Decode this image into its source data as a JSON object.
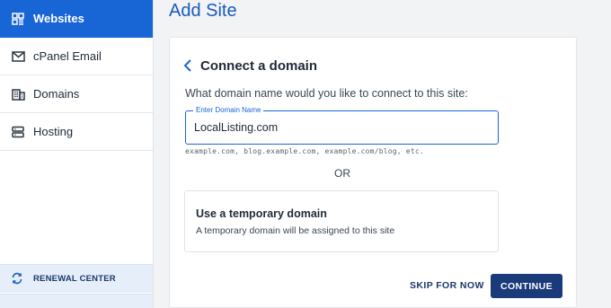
{
  "sidebar": {
    "items": [
      {
        "label": "Websites",
        "icon": "websites-grid-icon",
        "active": true
      },
      {
        "label": "cPanel Email",
        "icon": "envelope-icon",
        "active": false
      },
      {
        "label": "Domains",
        "icon": "building-icon",
        "active": false
      },
      {
        "label": "Hosting",
        "icon": "server-icon",
        "active": false
      }
    ],
    "renewal": {
      "label": "RENEWAL CENTER",
      "icon": "refresh-icon"
    }
  },
  "main": {
    "page_title": "Add Site",
    "card": {
      "heading": "Connect a domain",
      "back_icon": "chevron-left-icon",
      "question": "What domain name would you like to connect to this site:",
      "domain_field": {
        "label": "Enter Domain Name",
        "value": "LocalListing.com"
      },
      "hint": "example.com, blog.example.com, example.com/blog, etc.",
      "or_text": "OR",
      "temporary_option": {
        "title": "Use a temporary domain",
        "description": "A temporary domain will be assigned to this site"
      },
      "skip_label": "SKIP FOR NOW",
      "continue_label": "CONTINUE"
    }
  },
  "colors": {
    "accent": "#1865d6",
    "primary_button": "#1a3a7a",
    "title": "#1a5bbf",
    "renewal_bg": "#e6eef9"
  }
}
